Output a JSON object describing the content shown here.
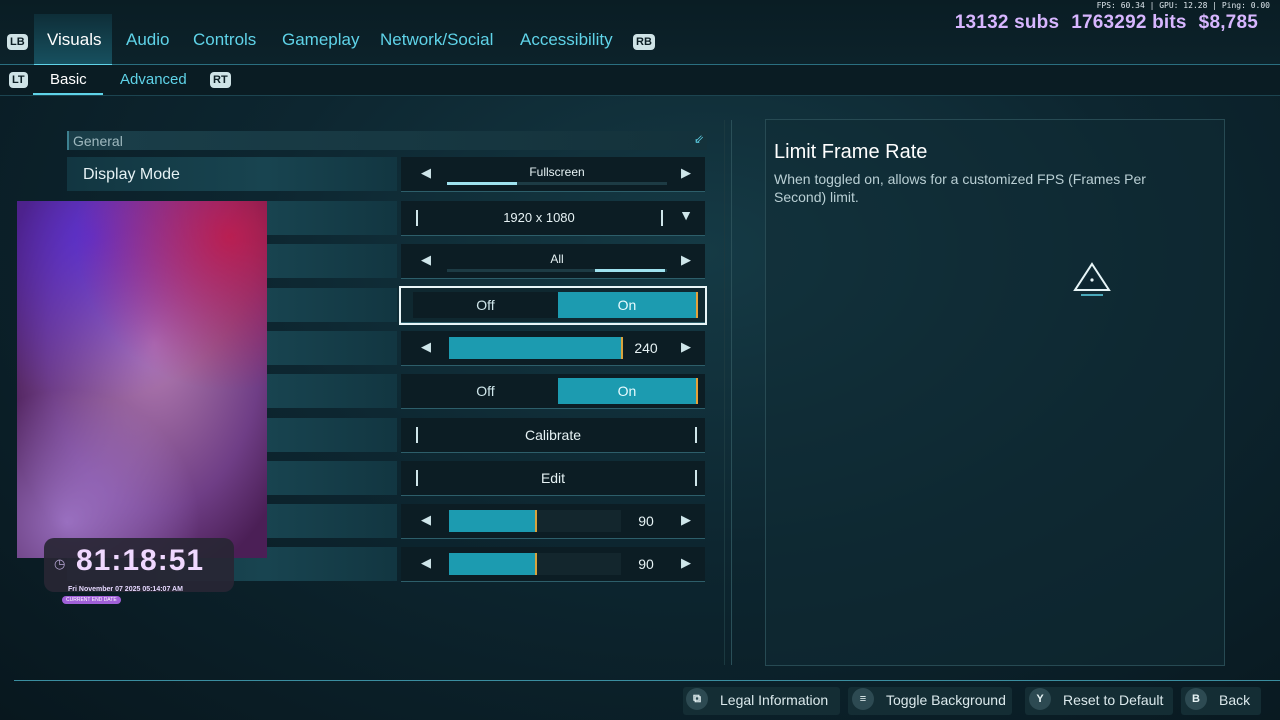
{
  "tabs": {
    "lb": "LB",
    "rb": "RB",
    "items": [
      "Visuals",
      "Audio",
      "Controls",
      "Gameplay",
      "Network/Social",
      "Accessibility"
    ],
    "active": "Visuals"
  },
  "subtabs": {
    "lt": "LT",
    "rt": "RT",
    "items": [
      "Basic",
      "Advanced"
    ],
    "active": "Basic"
  },
  "stream_overlay": {
    "stats": "FPS: 60.34 | GPU: 12.28 | Ping: 0.00",
    "subs": "13132 subs",
    "bits": "1763292 bits",
    "money": "$8,785",
    "timer": "81:18:51",
    "date": "Fri November 07 2025 05:14:07 AM",
    "tag": "CURRENT END DATE"
  },
  "settings": {
    "section": "General",
    "rows": [
      {
        "label": "Display Mode",
        "type": "selector",
        "value": "Fullscreen",
        "segments": 3,
        "selected_segment": 1
      },
      {
        "label": "",
        "type": "dropdown",
        "value": "1920 x 1080"
      },
      {
        "label": "",
        "type": "selector",
        "value": "All",
        "segments": 3,
        "selected_segment": 3
      },
      {
        "label": "",
        "type": "toggle",
        "off": "Off",
        "on": "On",
        "value": "On",
        "selected": true
      },
      {
        "label": "",
        "type": "slider",
        "value": "240",
        "fill_fraction": 1.0
      },
      {
        "label": "",
        "type": "toggle",
        "off": "Off",
        "on": "On",
        "value": "On"
      },
      {
        "label": "",
        "type": "button",
        "value": "Calibrate"
      },
      {
        "label": "",
        "type": "button",
        "value": "Edit"
      },
      {
        "label": "",
        "type": "slider",
        "value": "90",
        "fill_fraction": 0.5
      },
      {
        "label": "",
        "type": "slider",
        "value": "90",
        "fill_fraction": 0.5
      }
    ]
  },
  "description": {
    "title": "Limit Frame Rate",
    "body": "When toggled on, allows for a customized FPS (Frames Per Second) limit."
  },
  "footer": [
    {
      "glyph": "⧉",
      "label": "Legal Information"
    },
    {
      "glyph": "≡",
      "label": "Toggle Background"
    },
    {
      "glyph": "Y",
      "label": "Reset to Default"
    },
    {
      "glyph": "B",
      "label": "Back"
    }
  ],
  "colors": {
    "accent": "#5fd3e8",
    "fill": "#1c9bb0",
    "marker": "#d8a43e",
    "overlay_text": "#d7b6ff"
  }
}
